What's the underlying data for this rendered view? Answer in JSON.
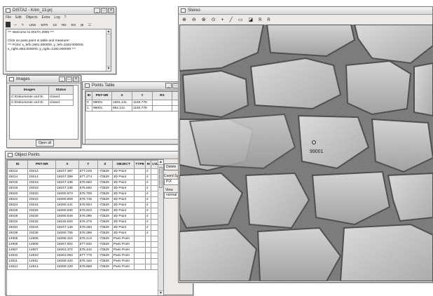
{
  "dista": {
    "title": "DISTA2 - Krim_13.prj",
    "menu": [
      "File",
      "Edit",
      "Objects",
      "Extra",
      "Log",
      "?"
    ],
    "tools": [
      "ꟷ",
      "✎",
      "LINK",
      "MTR",
      "1D",
      "RD",
      "RO",
      "⊞",
      "☷"
    ],
    "messages": [
      "*** Welcome to DISTA 2006 ***",
      "",
      "Click on pass point in table and measure!",
      "*** Point: x_left=1681.000000, y_left=1183.000000,",
      "x_right=852.000000, y_right=1160.000000 ***"
    ]
  },
  "images": {
    "title": "Images",
    "headers": [
      "Images",
      "Status"
    ],
    "rows": [
      [
        "C:\\Dokumente und Ei",
        "closed"
      ],
      [
        "C:\\Dokumente und Ei",
        "closed"
      ]
    ],
    "open_all": "Open all"
  },
  "points": {
    "title": "Points Table",
    "headers": [
      "ID",
      "PNT-NR",
      "X",
      "Y",
      "RX",
      "RY"
    ],
    "rows": [
      [
        "0",
        "99001",
        "1681.141",
        "1183.779",
        "",
        ""
      ],
      [
        "1",
        "99001",
        "852.141",
        "1160.779",
        "",
        ""
      ]
    ]
  },
  "objects": {
    "title": "Object Points",
    "headers": [
      "ID",
      "PNT-NR",
      "X",
      "Y",
      "Z",
      "OBJECT",
      "TYPE",
      "M",
      "LVL"
    ],
    "rows": [
      [
        "15012",
        "15012",
        "18247.387",
        "577.229",
        "-73629",
        "3D Point",
        "",
        "2",
        ""
      ],
      [
        "15014",
        "15014",
        "18247.399",
        "577.274",
        "-73629",
        "3D Point",
        "",
        "2",
        ""
      ],
      [
        "15016",
        "15016",
        "18247.235",
        "575.583",
        "-73629",
        "3D Point",
        "",
        "2",
        ""
      ],
      [
        "15018",
        "15018",
        "18247.235",
        "575.592",
        "-73629",
        "3D Point",
        "",
        "2",
        ""
      ],
      [
        "15020",
        "15020",
        "18250.873",
        "575.708",
        "-73629",
        "3D Point",
        "",
        "2",
        ""
      ],
      [
        "15022",
        "15022",
        "18250.809",
        "575.745",
        "-73629",
        "3D Point",
        "",
        "2",
        ""
      ],
      [
        "15024",
        "15024",
        "18250.441",
        "576.804",
        "-73629",
        "3D Point",
        "",
        "2",
        ""
      ],
      [
        "15026",
        "15026",
        "18250.630",
        "576.923",
        "-73629",
        "3D Point",
        "",
        "2",
        ""
      ],
      [
        "15028",
        "15028",
        "18250.649",
        "578.395",
        "-73629",
        "3D Point",
        "",
        "2",
        ""
      ],
      [
        "15032",
        "15032",
        "18246.820",
        "576.379",
        "-73629",
        "3D Point",
        "",
        "2",
        ""
      ],
      [
        "15034",
        "15034",
        "18247.148",
        "578.260",
        "-73629",
        "3D Point",
        "",
        "2",
        ""
      ],
      [
        "15036",
        "15036",
        "18250.705",
        "578.399",
        "-73629",
        "3D Point",
        "",
        "2",
        ""
      ],
      [
        "14905",
        "14905",
        "18268.316",
        "575.413",
        "-73629",
        "Pass Point",
        "",
        "",
        ""
      ],
      [
        "14906",
        "14906",
        "18267.902",
        "577.932",
        "-73629",
        "Pass Point",
        "",
        "",
        ""
      ],
      [
        "14907",
        "14907",
        "18263.372",
        "575.442",
        "-73629",
        "Pass Point",
        "",
        "",
        ""
      ],
      [
        "14910",
        "14910",
        "18263.063",
        "577.779",
        "-73629",
        "Pass Point",
        "",
        "",
        ""
      ],
      [
        "14911",
        "14911",
        "18259.420",
        "575.162",
        "-73629",
        "Pass Point",
        "",
        "",
        ""
      ],
      [
        "14914",
        "14914",
        "18259.220",
        "578.868",
        "-73629",
        "Pass Point",
        "",
        "",
        ""
      ]
    ]
  },
  "side": {
    "delete_label": "Delete",
    "coord_label": "Coord Sy",
    "pix_value": "PIX",
    "view_label": "View",
    "normal_value": "normal"
  },
  "stereo": {
    "title": "Stereo",
    "tools": [
      "⊕",
      "⊖",
      "⊗",
      "⊙",
      "+",
      "╱",
      "▭",
      "◪",
      "R",
      "R"
    ],
    "point_label": "99001"
  }
}
